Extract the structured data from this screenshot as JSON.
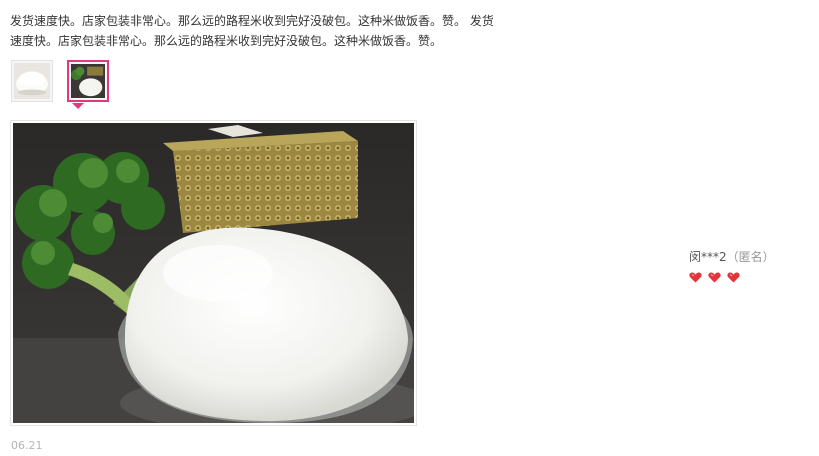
{
  "review": {
    "text": "发货速度快。店家包装非常心。那么远的路程米收到完好没破包。这种米做饭香。赞。 发货速度快。店家包装非常心。那么远的路程米收到完好没破包。这种米做饭香。赞。",
    "date": "06.21"
  },
  "thumbnails": [
    {
      "icon": "rice-bowl-photo-thumbnail",
      "active": false
    },
    {
      "icon": "rice-broccoli-photo-thumbnail",
      "active": true
    }
  ],
  "viewer": {
    "icon": "rice-bowl-with-broccoli-photo"
  },
  "user": {
    "name": "闵***2",
    "anonymous_label": "（匿名）",
    "level_hearts": 3
  },
  "colors": {
    "accent": "#e4387e",
    "heart": "#e3343b"
  }
}
